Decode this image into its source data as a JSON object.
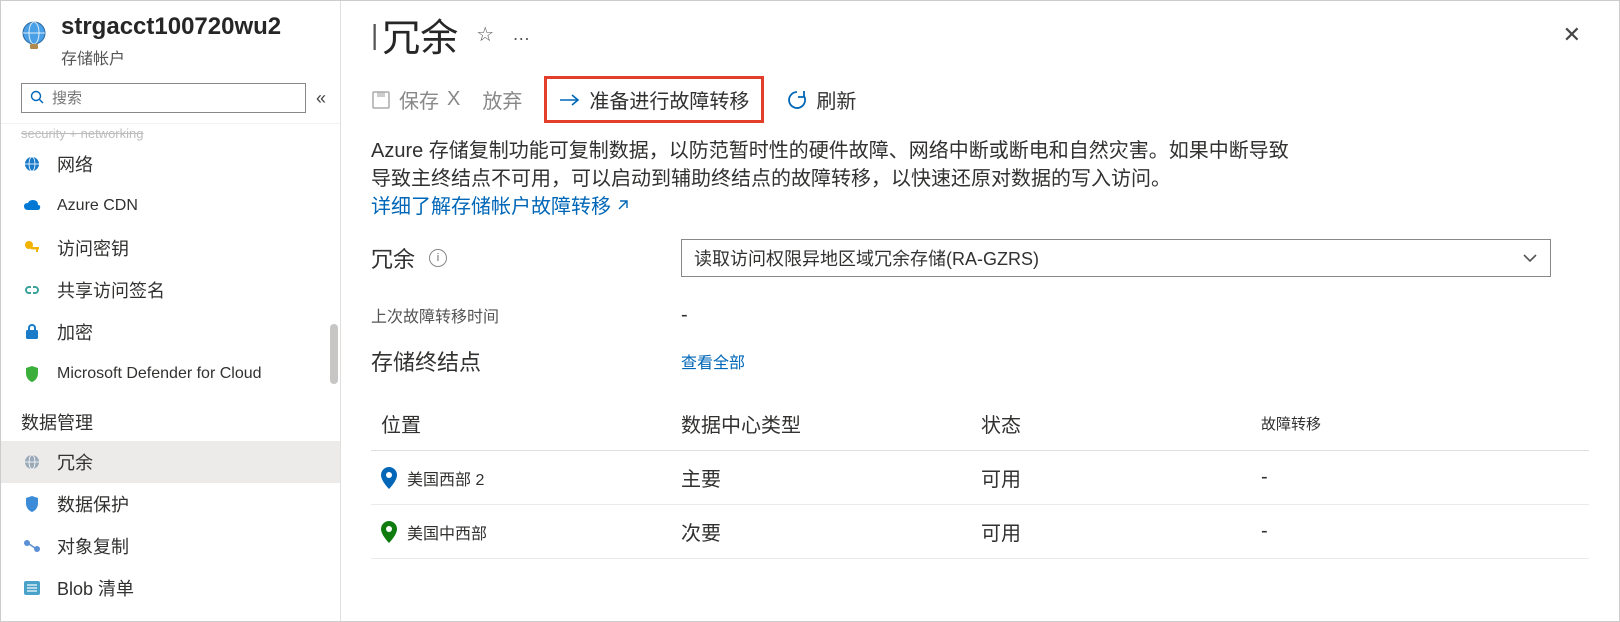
{
  "header": {
    "account_name": "strgacct100720wu2",
    "subtitle": "存储帐户",
    "page_title": "冗余"
  },
  "search": {
    "placeholder": "搜索"
  },
  "sidebar": {
    "cutoff": "security + networking",
    "items": [
      {
        "label": "网络",
        "icon": "globe"
      },
      {
        "label": "Azure CDN",
        "icon": "cloud",
        "small": true
      },
      {
        "label": "访问密钥",
        "icon": "key"
      },
      {
        "label": "共享访问签名",
        "icon": "link"
      },
      {
        "label": "加密",
        "icon": "lock"
      },
      {
        "label": "Microsoft Defender for Cloud",
        "icon": "shield",
        "small": true
      }
    ],
    "section": "数据管理",
    "data_items": [
      {
        "label": "冗余",
        "icon": "globe-gray",
        "active": true
      },
      {
        "label": "数据保护",
        "icon": "shield-blue"
      },
      {
        "label": "对象复制",
        "icon": "replicate"
      },
      {
        "label": "Blob 清单",
        "icon": "list"
      }
    ]
  },
  "commands": {
    "save": "保存",
    "discard": "放弃",
    "prepare_failover": "准备进行故障转移",
    "refresh": "刷新"
  },
  "description": {
    "l1": "Azure 存储复制功能可复制数据，以防范暂时性的硬件故障、网络中断或断电和自然灾害。如果中断导致",
    "l2": "导致主终结点不可用，可以启动到辅助终结点的故障转移，以快速还原对数据的写入访问。",
    "link": "详细了解存储帐户故障转移"
  },
  "fields": {
    "redundancy_label": "冗余",
    "redundancy_value": "读取访问权限异地区域冗余存储(RA-GZRS)",
    "last_failover_label": "上次故障转移时间",
    "last_failover_value": "-",
    "endpoints_label": "存储终结点",
    "endpoints_link": "查看全部"
  },
  "table": {
    "headers": {
      "location": "位置",
      "dc_type": "数据中心类型",
      "status": "状态",
      "failover": "故障转移"
    },
    "rows": [
      {
        "location": "美国西部 2",
        "pin": "#0067b8",
        "dc_type": "主要",
        "status": "可用",
        "failover": "-"
      },
      {
        "location": "美国中西部",
        "pin": "#107c10",
        "dc_type": "次要",
        "status": "可用",
        "failover": "-"
      }
    ]
  }
}
